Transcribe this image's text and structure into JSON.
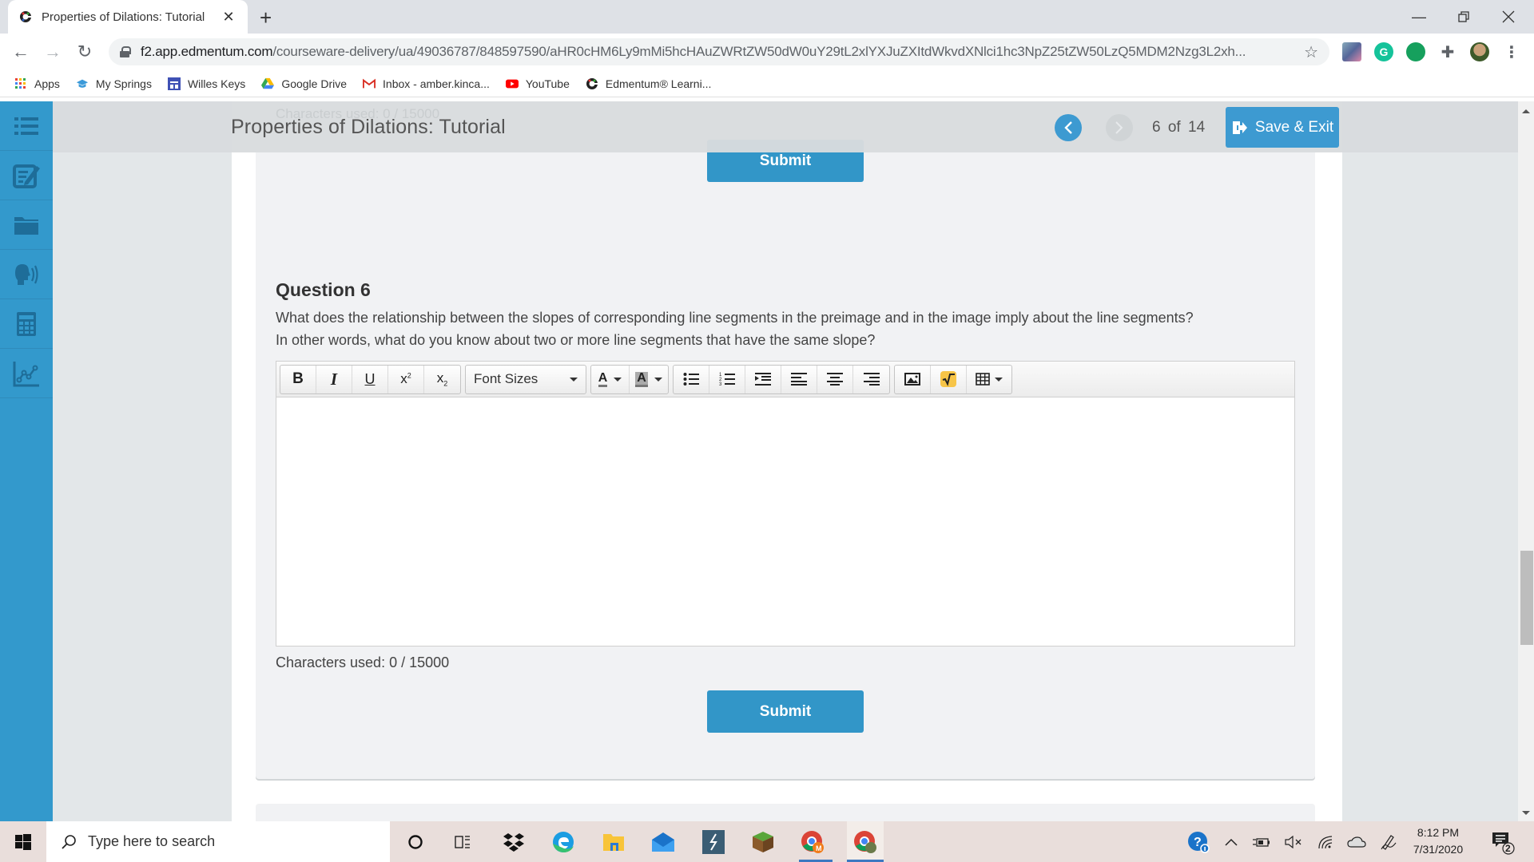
{
  "browser": {
    "tab_title": "Properties of Dilations: Tutorial",
    "url_host": "f2.app.edmentum.com",
    "url_path": "/courseware-delivery/ua/49036787/848597590/aHR0cHM6Ly9mMi5hcHAuZWRtZW50dW0uY29tL2xlYXJuZXItdWkvdXNlci1hc3NpZ25tZW50LzQ5MDM2Nzg3L2xh...",
    "extensions": [
      "extension-image-icon",
      "grammarly-icon",
      "green-chat-icon",
      "extensions-puzzle-icon",
      "profile-avatar"
    ],
    "bookmarks": [
      {
        "label": "Apps",
        "icon": "apps-grid-icon"
      },
      {
        "label": "My Springs",
        "icon": "graduation-cap-icon"
      },
      {
        "label": "Willes Keys",
        "icon": "forms-icon"
      },
      {
        "label": "Google Drive",
        "icon": "google-drive-icon"
      },
      {
        "label": "Inbox - amber.kinca...",
        "icon": "gmail-icon"
      },
      {
        "label": "YouTube",
        "icon": "youtube-icon"
      },
      {
        "label": "Edmentum® Learni...",
        "icon": "edmentum-icon"
      }
    ]
  },
  "app": {
    "lesson_title": "Properties of Dilations: Tutorial",
    "ghost_char_count": "Characters used: 0 / 15000",
    "pager": {
      "current": "6",
      "of_label": "of",
      "total": "14"
    },
    "save_exit_label": "Save & Exit",
    "sidebar": [
      "table-of-contents-icon",
      "notes-icon",
      "folder-icon",
      "text-to-speech-icon",
      "calculator-icon",
      "graph-icon"
    ],
    "accent_color": "#3d9ad1"
  },
  "previous_question": {
    "submit_label": "Submit"
  },
  "question": {
    "heading": "Question 6",
    "line1": "What does the relationship between the slopes of corresponding line segments in the preimage and in the image imply about the line segments?",
    "line2": "In other words, what do you know about two or more line segments that have the same slope?",
    "editor": {
      "font_sizes_label": "Font Sizes",
      "content": ""
    },
    "char_count": "Characters used: 0 / 15000",
    "submit_label": "Submit"
  },
  "taskbar": {
    "search_placeholder": "Type here to search",
    "time": "8:12 PM",
    "date": "7/31/2020",
    "notification_count": "2"
  }
}
